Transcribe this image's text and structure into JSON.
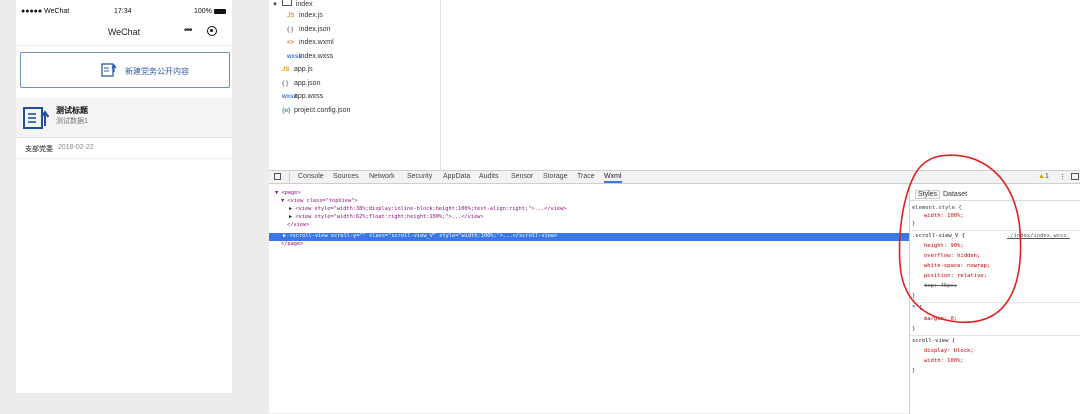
{
  "phone": {
    "status": {
      "carrier": "●●●●● WeChat",
      "time": "17:34",
      "battery": "100%"
    },
    "nav_title": "WeChat",
    "new_button_label": "新建党务公开内容",
    "item": {
      "title": "测试标题",
      "subtitle": "测试数据1"
    },
    "meta": {
      "tag": "支部党委",
      "date": "2018-02-22"
    }
  },
  "filetree": {
    "folder": "index",
    "files": [
      {
        "icon": "JS",
        "name": "index.js",
        "color": "#d4a017"
      },
      {
        "icon": "{ }",
        "name": "index.json",
        "color": "#7a7a7a"
      },
      {
        "icon": "<>",
        "name": "index.wxml",
        "color": "#e06c4f"
      },
      {
        "icon": "wxss",
        "name": "index.wxss",
        "color": "#3b78e7"
      },
      {
        "icon": "JS",
        "name": "app.js",
        "color": "#d4a017"
      },
      {
        "icon": "{ }",
        "name": "app.json",
        "color": "#7a7a7a"
      },
      {
        "icon": "wxss",
        "name": "app.wxss",
        "color": "#3b78e7"
      },
      {
        "icon": "{o}",
        "name": "project.config.json",
        "color": "#2e9e5b"
      }
    ]
  },
  "devtools": {
    "tabs": [
      "Console",
      "Sources",
      "Network",
      "Security",
      "AppData",
      "Audits",
      "Sensor",
      "Storage",
      "Trace",
      "Wxml"
    ],
    "active_tab": "Wxml",
    "warning_count": "1",
    "wxml": {
      "page_open": "<page>",
      "view_open": "<view class=\"topView\">",
      "view1": "<view style=\"width:38%;display:inline-block;height:100%;text-align:right;\">...</view>",
      "view2": "<view style=\"width:62%;float:right;height:100%;\">...</view>",
      "view_close": "</view>",
      "selected": "<scroll-view scroll-y=\"\" class=\"scroll-view_V\" style=\"width:100%;\">...</scroll-view>",
      "page_close": "</page>"
    },
    "styles": {
      "tabs": [
        "Styles",
        "Dataset"
      ],
      "element_style": "element.style {",
      "element_width": "width: 100%;",
      "rule_selector": ".scroll-view_V {",
      "rule_source": "./index/index.wxss:",
      "rule_props": [
        "height: 90%;",
        "overflow: hidden;",
        "white-space: nowrap;",
        "position: relative;"
      ],
      "rule_struck": "top: 45px;",
      "star_selector": "* {",
      "star_prop": "margin: 0;",
      "sv_selector": "scroll-view {",
      "sv_props": [
        "display: block;",
        "width: 100%;"
      ],
      "close": "}"
    }
  },
  "colors": {
    "accent": "#3b78e7",
    "annotation": "#e02020"
  }
}
